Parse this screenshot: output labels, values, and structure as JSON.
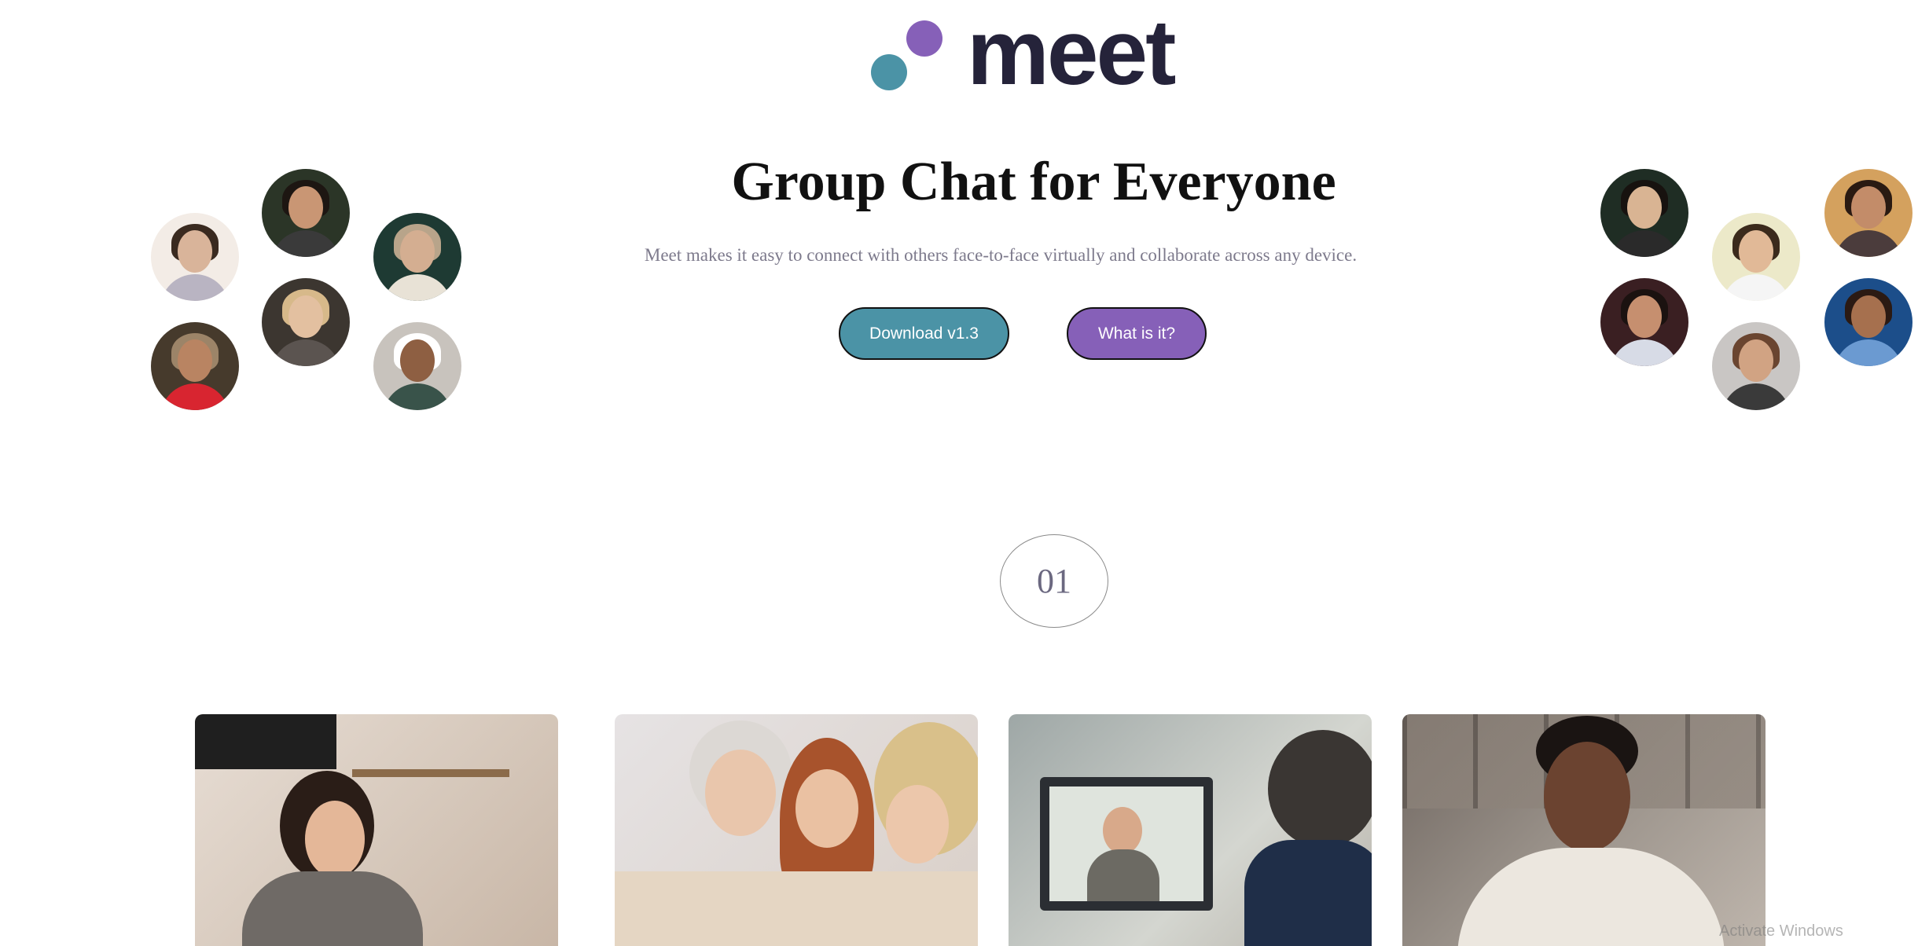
{
  "brand": {
    "name": "meet",
    "colors": {
      "text": "#25233a",
      "teal": "#4b93a6",
      "purple": "#8660b8"
    }
  },
  "hero": {
    "title": "Group Chat for Everyone",
    "subtitle": "Meet makes it easy to connect with others face-to-face virtually and collaborate across any device.",
    "subtitle_color": "#7d7a8c"
  },
  "buttons": {
    "download": {
      "label": "Download v1.3",
      "color": "#4b93a6"
    },
    "what_is_it": {
      "label": "What is it?",
      "color": "#8660b8"
    }
  },
  "avatars": {
    "left": [
      {
        "name": "avatar-young-man",
        "bg": "#f3ece6",
        "hair": "#3a2a20",
        "face": "#d9b49a",
        "body": "#b9b4c2"
      },
      {
        "name": "avatar-smiling-woman",
        "bg": "#2b3527",
        "hair": "#1d1612",
        "face": "#c99674",
        "body": "#3a3a3a"
      },
      {
        "name": "avatar-bearded-man",
        "bg": "#1e3a33",
        "hair": "#b8a48a",
        "face": "#d4ae91",
        "body": "#e8e2d6"
      },
      {
        "name": "avatar-laughing-man-hat",
        "bg": "#463a2c",
        "hair": "#9c8468",
        "face": "#b98462",
        "body": "#d82530"
      },
      {
        "name": "avatar-blonde-woman",
        "bg": "#3c3630",
        "hair": "#d7b98a",
        "face": "#e3c0a0",
        "body": "#5b5450"
      },
      {
        "name": "avatar-older-man",
        "bg": "#c8c3bd",
        "hair": "#ffffff",
        "face": "#8e5f42",
        "body": "#39534a"
      }
    ],
    "right": [
      {
        "name": "avatar-man-sunglasses",
        "bg": "#1f2d24",
        "hair": "#17120f",
        "face": "#d9b493",
        "body": "#2a2a2a"
      },
      {
        "name": "avatar-excited-man",
        "bg": "#ece9c9",
        "hair": "#3b2a1c",
        "face": "#e1b997",
        "body": "#f5f5f5"
      },
      {
        "name": "avatar-couple",
        "bg": "#d4a15e",
        "hair": "#2a1a12",
        "face": "#c38c69",
        "body": "#4b3c3c"
      },
      {
        "name": "avatar-man-flowers",
        "bg": "#3a1f22",
        "hair": "#1b1210",
        "face": "#c68f6f",
        "body": "#d7dbe6"
      },
      {
        "name": "avatar-curly-man",
        "bg": "#c9c6c4",
        "hair": "#6a4530",
        "face": "#d1a383",
        "body": "#3a3a3a"
      },
      {
        "name": "avatar-woman-denim",
        "bg": "#1c4e8a",
        "hair": "#2b1a13",
        "face": "#a6704e",
        "body": "#6b9ad1"
      }
    ]
  },
  "step": {
    "number": "01",
    "color": "#6b6880"
  },
  "cards": [
    {
      "name": "photo-woman-headset-kitchen"
    },
    {
      "name": "photo-three-women-phone"
    },
    {
      "name": "photo-video-call-laptop"
    },
    {
      "name": "photo-man-smiling-phone"
    }
  ],
  "watermark": "Activate Windows"
}
